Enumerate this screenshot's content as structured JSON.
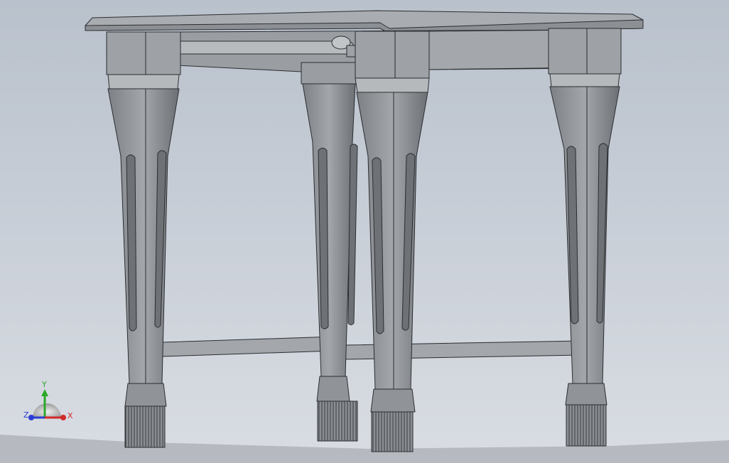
{
  "viewport": {
    "background_top": "#b9c1cc",
    "background_bottom": "#d9dde3",
    "model_fill": "#8f9398",
    "model_dark": "#6e7276",
    "model_light": "#b4b7bb",
    "edge_color": "#2b2d30",
    "shadow_color": "#6a6d72"
  },
  "triad": {
    "x_label": "X",
    "y_label": "Y",
    "z_label": "Z",
    "x_color": "#d22a2a",
    "y_color": "#2aa82a",
    "z_color": "#2a3fd2"
  }
}
